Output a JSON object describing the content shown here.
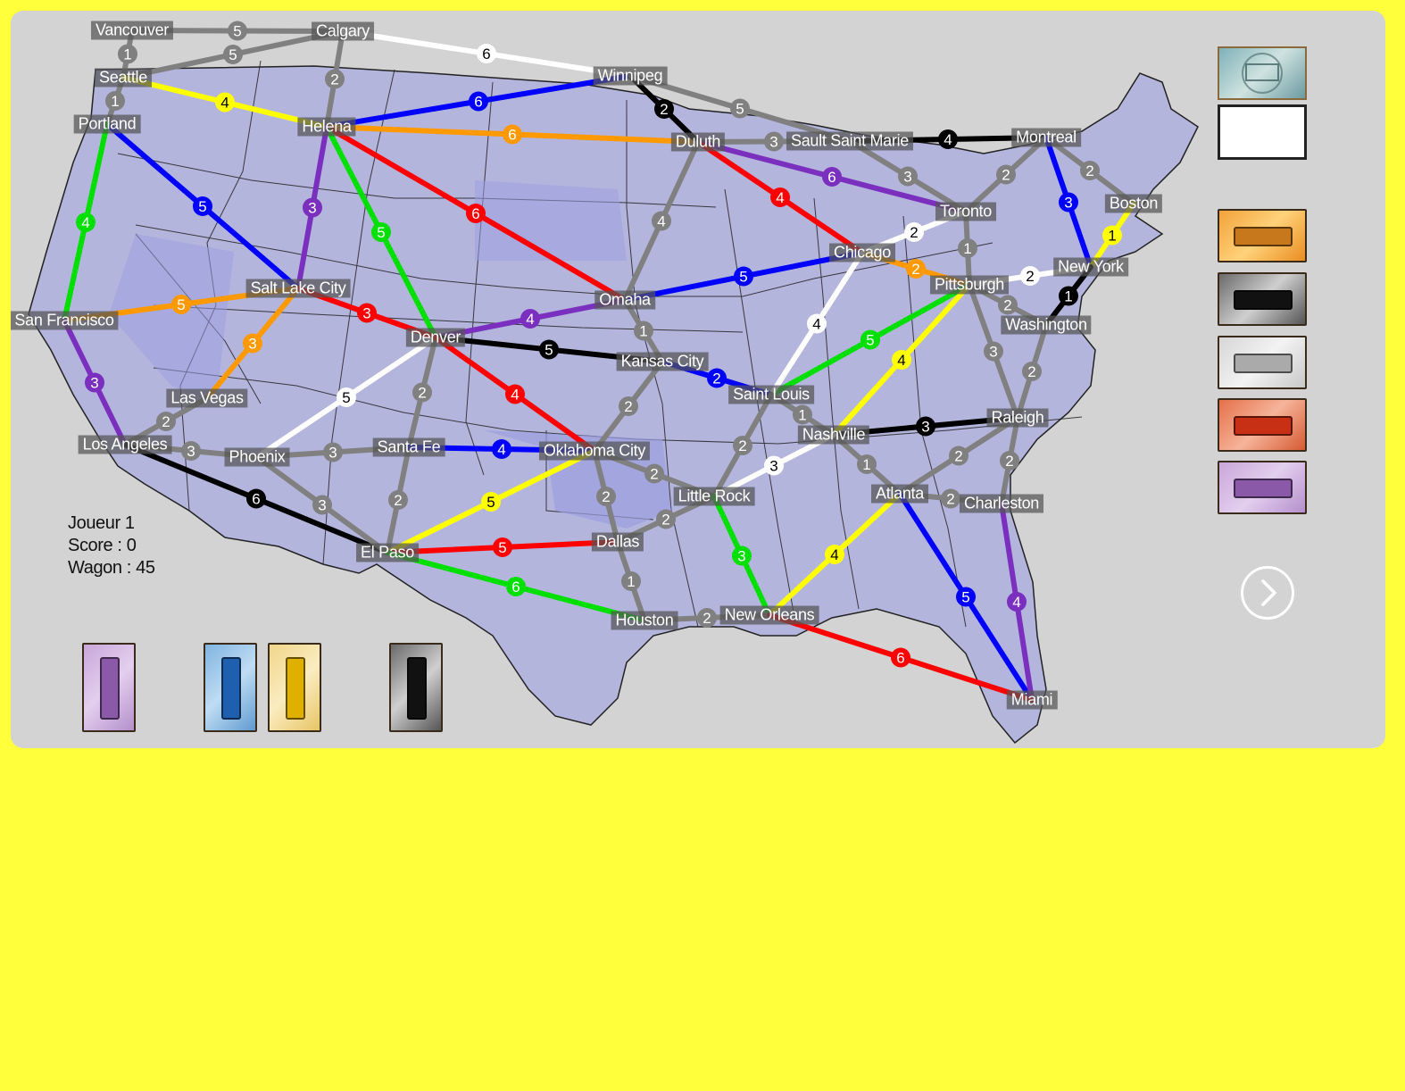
{
  "colors": {
    "background": "#ffff3c",
    "board": "#d3d3d3",
    "red": "#ff0000",
    "blue": "#0000ff",
    "green": "#00e000",
    "yellow": "#ffff00",
    "orange": "#ff9900",
    "purple": "#7b2fbe",
    "black": "#000000",
    "white": "#ffffff",
    "gray": "#808080"
  },
  "player": {
    "player_label": "Joueur 1",
    "score_label": "Score : 0",
    "wagon_label": "Wagon : 45"
  },
  "cities": [
    {
      "id": "vancouver",
      "name": "Vancouver"
    },
    {
      "id": "calgary",
      "name": "Calgary"
    },
    {
      "id": "seattle",
      "name": "Seattle"
    },
    {
      "id": "portland",
      "name": "Portland"
    },
    {
      "id": "helena",
      "name": "Helena"
    },
    {
      "id": "winnipeg",
      "name": "Winnipeg"
    },
    {
      "id": "duluth",
      "name": "Duluth"
    },
    {
      "id": "saultstemarie",
      "name": "Sault Saint Marie"
    },
    {
      "id": "montreal",
      "name": "Montreal"
    },
    {
      "id": "toronto",
      "name": "Toronto"
    },
    {
      "id": "boston",
      "name": "Boston"
    },
    {
      "id": "newyork",
      "name": "New York"
    },
    {
      "id": "pittsburgh",
      "name": "Pittsburgh"
    },
    {
      "id": "washington",
      "name": "Washington"
    },
    {
      "id": "chicago",
      "name": "Chicago"
    },
    {
      "id": "omaha",
      "name": "Omaha"
    },
    {
      "id": "saltlake",
      "name": "Salt Lake City"
    },
    {
      "id": "sanfrancisco",
      "name": "San Francisco"
    },
    {
      "id": "denver",
      "name": "Denver"
    },
    {
      "id": "kansascity",
      "name": "Kansas City"
    },
    {
      "id": "saintlouis",
      "name": "Saint Louis"
    },
    {
      "id": "nashville",
      "name": "Nashville"
    },
    {
      "id": "raleigh",
      "name": "Raleigh"
    },
    {
      "id": "lasvegas",
      "name": "Las Vegas"
    },
    {
      "id": "losangeles",
      "name": "Los Angeles"
    },
    {
      "id": "phoenix",
      "name": "Phoenix"
    },
    {
      "id": "santafe",
      "name": "Santa Fe"
    },
    {
      "id": "oklahomacity",
      "name": "Oklahoma City"
    },
    {
      "id": "littlerock",
      "name": "Little Rock"
    },
    {
      "id": "atlanta",
      "name": "Atlanta"
    },
    {
      "id": "charleston",
      "name": "Charleston"
    },
    {
      "id": "elpaso",
      "name": "El Paso"
    },
    {
      "id": "dallas",
      "name": "Dallas"
    },
    {
      "id": "houston",
      "name": "Houston"
    },
    {
      "id": "neworleans",
      "name": "New Orleans"
    },
    {
      "id": "miami",
      "name": "Miami"
    }
  ],
  "routes": [
    {
      "from": "vancouver",
      "to": "calgary",
      "color": "gray",
      "length": 5
    },
    {
      "from": "vancouver",
      "to": "seattle",
      "color": "gray",
      "length": 1
    },
    {
      "from": "seattle",
      "to": "calgary",
      "color": "gray",
      "length": 5
    },
    {
      "from": "seattle",
      "to": "portland",
      "color": "gray",
      "length": 1
    },
    {
      "from": "seattle",
      "to": "helena",
      "color": "yellow",
      "length": 4
    },
    {
      "from": "calgary",
      "to": "helena",
      "color": "gray",
      "length": 2
    },
    {
      "from": "calgary",
      "to": "winnipeg",
      "color": "white",
      "length": 6
    },
    {
      "from": "helena",
      "to": "winnipeg",
      "color": "blue",
      "length": 6
    },
    {
      "from": "helena",
      "to": "duluth",
      "color": "orange",
      "length": 6
    },
    {
      "from": "helena",
      "to": "omaha",
      "color": "red",
      "length": 6
    },
    {
      "from": "helena",
      "to": "denver",
      "color": "green",
      "length": 5
    },
    {
      "from": "helena",
      "to": "saltlake",
      "color": "purple",
      "length": 3
    },
    {
      "from": "portland",
      "to": "saltlake",
      "color": "blue",
      "length": 5
    },
    {
      "from": "portland",
      "to": "sanfrancisco",
      "color": "green",
      "length": 4
    },
    {
      "from": "sanfrancisco",
      "to": "saltlake",
      "color": "orange",
      "length": 5
    },
    {
      "from": "sanfrancisco",
      "to": "losangeles",
      "color": "purple",
      "length": 3
    },
    {
      "from": "saltlake",
      "to": "lasvegas",
      "color": "orange",
      "length": 3
    },
    {
      "from": "saltlake",
      "to": "denver",
      "color": "red",
      "length": 3
    },
    {
      "from": "lasvegas",
      "to": "losangeles",
      "color": "gray",
      "length": 2
    },
    {
      "from": "losangeles",
      "to": "phoenix",
      "color": "gray",
      "length": 3
    },
    {
      "from": "losangeles",
      "to": "elpaso",
      "color": "black",
      "length": 6
    },
    {
      "from": "phoenix",
      "to": "denver",
      "color": "white",
      "length": 5
    },
    {
      "from": "phoenix",
      "to": "santafe",
      "color": "gray",
      "length": 3
    },
    {
      "from": "phoenix",
      "to": "elpaso",
      "color": "gray",
      "length": 3
    },
    {
      "from": "denver",
      "to": "santafe",
      "color": "gray",
      "length": 2
    },
    {
      "from": "denver",
      "to": "omaha",
      "color": "purple",
      "length": 4
    },
    {
      "from": "denver",
      "to": "kansascity",
      "color": "black",
      "length": 5
    },
    {
      "from": "denver",
      "to": "oklahomacity",
      "color": "red",
      "length": 4
    },
    {
      "from": "santafe",
      "to": "elpaso",
      "color": "gray",
      "length": 2
    },
    {
      "from": "santafe",
      "to": "oklahomacity",
      "color": "blue",
      "length": 4
    },
    {
      "from": "elpaso",
      "to": "oklahomacity",
      "color": "yellow",
      "length": 5
    },
    {
      "from": "elpaso",
      "to": "dallas",
      "color": "red",
      "length": 5
    },
    {
      "from": "elpaso",
      "to": "houston",
      "color": "green",
      "length": 6
    },
    {
      "from": "winnipeg",
      "to": "duluth",
      "color": "black",
      "length": 2
    },
    {
      "from": "winnipeg",
      "to": "saultstemarie",
      "color": "gray",
      "length": 5
    },
    {
      "from": "duluth",
      "to": "saultstemarie",
      "color": "gray",
      "length": 3
    },
    {
      "from": "duluth",
      "to": "toronto",
      "color": "purple",
      "length": 6
    },
    {
      "from": "duluth",
      "to": "chicago",
      "color": "red",
      "length": 4
    },
    {
      "from": "duluth",
      "to": "omaha",
      "color": "gray",
      "length": 4
    },
    {
      "from": "saultstemarie",
      "to": "montreal",
      "color": "black",
      "length": 4
    },
    {
      "from": "saultstemarie",
      "to": "toronto",
      "color": "gray",
      "length": 3
    },
    {
      "from": "toronto",
      "to": "montreal",
      "color": "gray",
      "length": 2
    },
    {
      "from": "toronto",
      "to": "chicago",
      "color": "white",
      "length": 2
    },
    {
      "from": "toronto",
      "to": "pittsburgh",
      "color": "gray",
      "length": 1
    },
    {
      "from": "montreal",
      "to": "boston",
      "color": "gray",
      "length": 2
    },
    {
      "from": "montreal",
      "to": "newyork",
      "color": "blue",
      "length": 3
    },
    {
      "from": "boston",
      "to": "newyork",
      "color": "yellow",
      "length": 1
    },
    {
      "from": "newyork",
      "to": "pittsburgh",
      "color": "white",
      "length": 2
    },
    {
      "from": "newyork",
      "to": "washington",
      "color": "black",
      "length": 1
    },
    {
      "from": "pittsburgh",
      "to": "washington",
      "color": "gray",
      "length": 2
    },
    {
      "from": "pittsburgh",
      "to": "chicago",
      "color": "orange",
      "length": 2
    },
    {
      "from": "pittsburgh",
      "to": "saintlouis",
      "color": "green",
      "length": 5
    },
    {
      "from": "pittsburgh",
      "to": "nashville",
      "color": "yellow",
      "length": 4
    },
    {
      "from": "pittsburgh",
      "to": "raleigh",
      "color": "gray",
      "length": 3
    },
    {
      "from": "washington",
      "to": "raleigh",
      "color": "gray",
      "length": 2
    },
    {
      "from": "chicago",
      "to": "omaha",
      "color": "blue",
      "length": 5
    },
    {
      "from": "chicago",
      "to": "saintlouis",
      "color": "white",
      "length": 4
    },
    {
      "from": "omaha",
      "to": "kansascity",
      "color": "gray",
      "length": 1
    },
    {
      "from": "kansascity",
      "to": "saintlouis",
      "color": "blue",
      "length": 2
    },
    {
      "from": "kansascity",
      "to": "oklahomacity",
      "color": "gray",
      "length": 2
    },
    {
      "from": "saintlouis",
      "to": "nashville",
      "color": "gray",
      "length": 1
    },
    {
      "from": "saintlouis",
      "to": "littlerock",
      "color": "gray",
      "length": 2
    },
    {
      "from": "nashville",
      "to": "raleigh",
      "color": "black",
      "length": 3
    },
    {
      "from": "nashville",
      "to": "atlanta",
      "color": "gray",
      "length": 1
    },
    {
      "from": "nashville",
      "to": "littlerock",
      "color": "white",
      "length": 3
    },
    {
      "from": "raleigh",
      "to": "atlanta",
      "color": "gray",
      "length": 2
    },
    {
      "from": "raleigh",
      "to": "charleston",
      "color": "gray",
      "length": 2
    },
    {
      "from": "atlanta",
      "to": "charleston",
      "color": "gray",
      "length": 2
    },
    {
      "from": "atlanta",
      "to": "neworleans",
      "color": "yellow",
      "length": 4
    },
    {
      "from": "atlanta",
      "to": "miami",
      "color": "blue",
      "length": 5
    },
    {
      "from": "charleston",
      "to": "miami",
      "color": "purple",
      "length": 4
    },
    {
      "from": "oklahomacity",
      "to": "littlerock",
      "color": "gray",
      "length": 2
    },
    {
      "from": "oklahomacity",
      "to": "dallas",
      "color": "gray",
      "length": 2
    },
    {
      "from": "littlerock",
      "to": "dallas",
      "color": "gray",
      "length": 2
    },
    {
      "from": "littlerock",
      "to": "neworleans",
      "color": "green",
      "length": 3
    },
    {
      "from": "dallas",
      "to": "houston",
      "color": "gray",
      "length": 1
    },
    {
      "from": "houston",
      "to": "neworleans",
      "color": "gray",
      "length": 2
    },
    {
      "from": "neworleans",
      "to": "miami",
      "color": "red",
      "length": 6
    }
  ],
  "hand_cards": [
    {
      "name": "purple-wagon-card",
      "color": "purple"
    },
    {
      "name": "blue-wagon-card",
      "color": "blue"
    },
    {
      "name": "yellow-wagon-card",
      "color": "yellow"
    },
    {
      "name": "black-wagon-card",
      "color": "black"
    }
  ],
  "face_up_cards": [
    {
      "name": "orange-wagon-card",
      "color": "orange"
    },
    {
      "name": "black-wagon-card",
      "color": "black"
    },
    {
      "name": "white-wagon-card",
      "color": "white"
    },
    {
      "name": "red-wagon-card",
      "color": "red"
    },
    {
      "name": "purple-wagon-card",
      "color": "purple"
    }
  ],
  "icons": {
    "next": "chevron-right-icon",
    "destination_deck": "locomotive-icon"
  }
}
